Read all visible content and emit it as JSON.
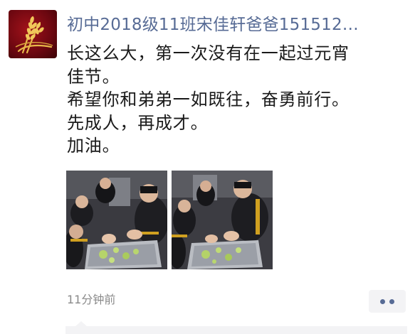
{
  "post": {
    "author_name": "初中2018级11班宋佳轩爸爸151512…",
    "text_lines": [
      "长这么大，第一次没有在一起过元宵",
      "佳节。",
      "希望你和弟弟一如既往，奋勇前行。",
      "先成人，再成才。",
      "加油。"
    ],
    "timestamp": "11分钟前",
    "photos": [
      {
        "icon": "photo-students-baking"
      },
      {
        "icon": "photo-students-baking"
      }
    ]
  },
  "colors": {
    "link_blue": "#576b95",
    "text": "#1a1a1a",
    "muted": "#8a8a8a",
    "panel": "#f3f3f5"
  }
}
